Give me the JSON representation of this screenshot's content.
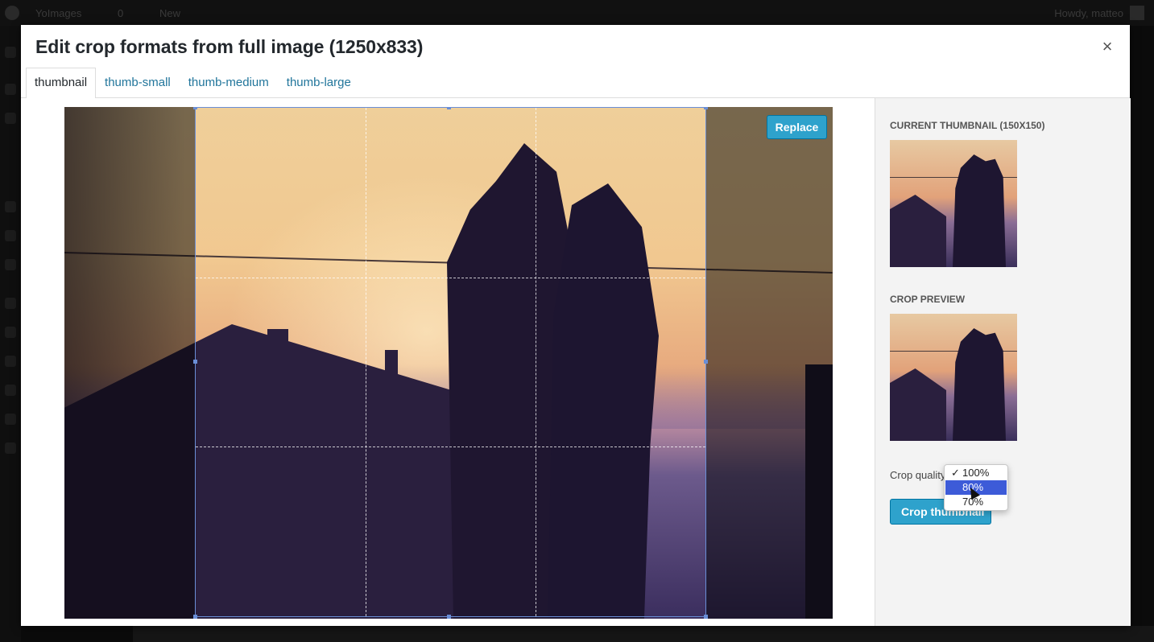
{
  "admin_bar": {
    "site_name": "YoImages",
    "comments_count": "0",
    "new_label": "New",
    "howdy": "Howdy, matteo"
  },
  "modal": {
    "title": "Edit crop formats from full image (1250x833)",
    "close_glyph": "×",
    "tabs": [
      {
        "label": "thumbnail",
        "active": true
      },
      {
        "label": "thumb-small",
        "active": false
      },
      {
        "label": "thumb-medium",
        "active": false
      },
      {
        "label": "thumb-large",
        "active": false
      }
    ],
    "replace_label": "Replace"
  },
  "sidebar": {
    "current_thumbnail_label": "CURRENT THUMBNAIL (150X150)",
    "crop_preview_label": "CROP PREVIEW",
    "crop_quality_label": "Crop quality",
    "crop_button_label": "Crop thumbnail",
    "quality_options": [
      {
        "label": "100%",
        "selected": true,
        "highlighted": false
      },
      {
        "label": "80%",
        "selected": false,
        "highlighted": true
      },
      {
        "label": "70%",
        "selected": false,
        "highlighted": false
      }
    ],
    "check_glyph": "✓"
  },
  "colors": {
    "accent": "#2ea2cc",
    "link": "#21759b",
    "highlight": "#3d5bd8",
    "crop_border": "#6a8ed6"
  }
}
